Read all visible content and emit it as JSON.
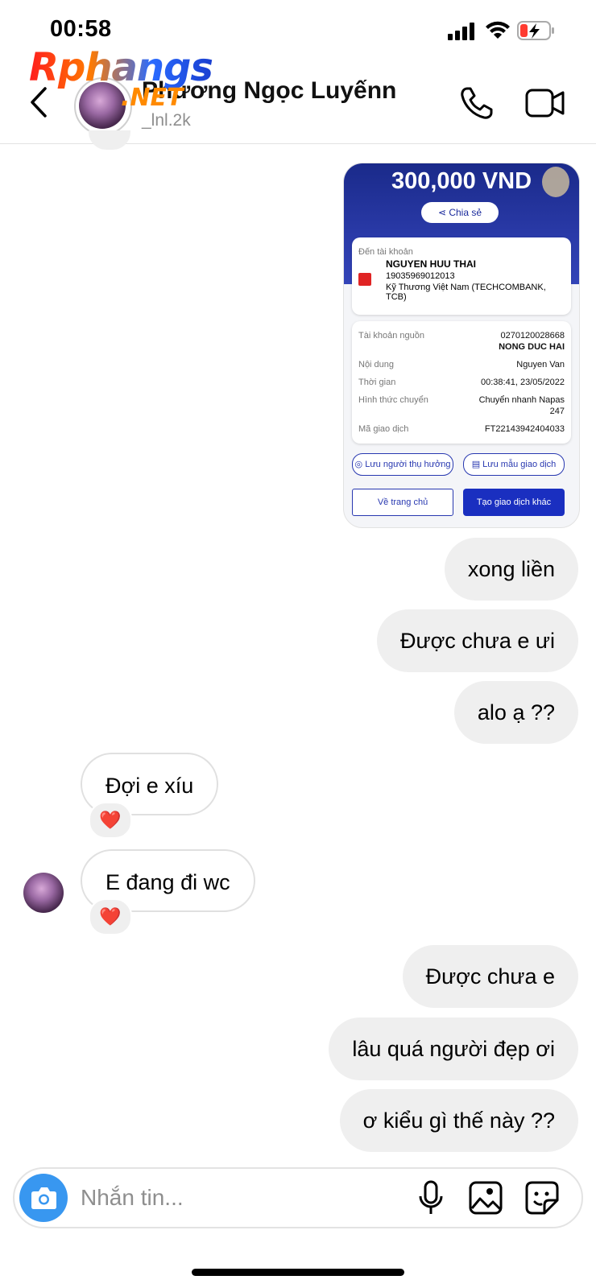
{
  "status_bar": {
    "time": "00:58"
  },
  "watermark": {
    "text": "Rphangs",
    "suffix": ".NET"
  },
  "header": {
    "name": "Phương Ngọc Luyếnn",
    "username": "_lnl.2k"
  },
  "transfer_card": {
    "amount": "300,000 VND",
    "share_label": "Chia sẻ",
    "to_account_label": "Đến tài khoản",
    "recipient_name": "NGUYEN HUU THAI",
    "recipient_account": "19035969012013",
    "recipient_bank": "Kỹ Thương Việt Nam (TECHCOMBANK, TCB)",
    "details": [
      {
        "label": "Tài khoản nguồn",
        "value": "0270120028668",
        "value2": "NONG DUC HAI"
      },
      {
        "label": "Nội dung",
        "value": "Nguyen Van"
      },
      {
        "label": "Thời gian",
        "value": "00:38:41, 23/05/2022"
      },
      {
        "label": "Hình thức chuyển",
        "value": "Chuyển nhanh Napas",
        "value2": "247"
      },
      {
        "label": "Mã giao dịch",
        "value": "FT22143942404033"
      }
    ],
    "save_beneficiary": "Lưu người thụ hưởng",
    "save_template": "Lưu mẫu giao dịch",
    "home_button": "Về trang chủ",
    "new_transaction_button": "Tạo giao dịch khác"
  },
  "messages": [
    {
      "text": "xong liền"
    },
    {
      "text": "Được chưa e ưi"
    },
    {
      "text": "alo ạ ??"
    },
    {
      "text": "Đợi e xíu",
      "reaction": "❤️"
    },
    {
      "text": "E đang đi wc",
      "reaction": "❤️"
    },
    {
      "text": "Được chưa e"
    },
    {
      "text": "lâu quá người đẹp ơi"
    },
    {
      "text": "ơ kiểu gì thế này ??"
    }
  ],
  "composer": {
    "placeholder": "Nhắn tin..."
  }
}
